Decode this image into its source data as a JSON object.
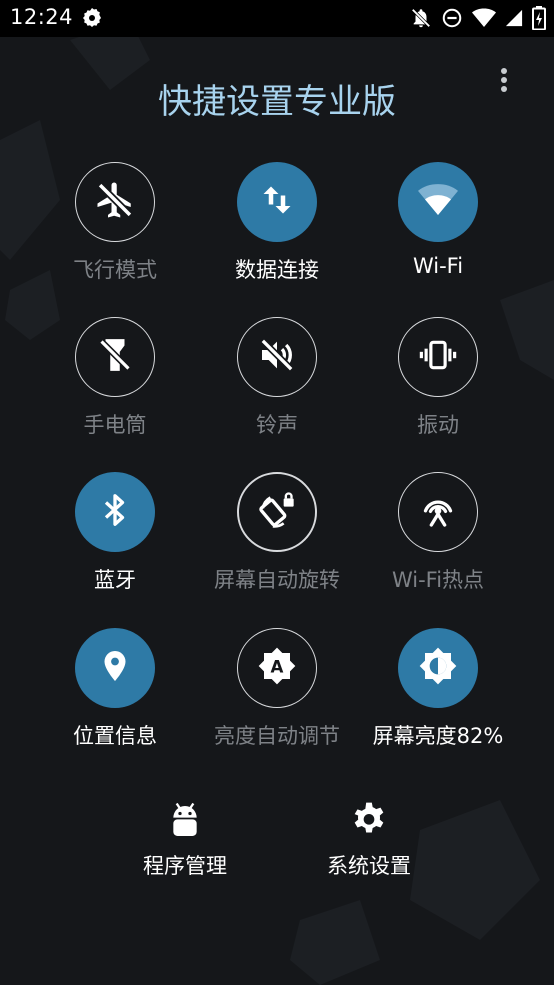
{
  "status_bar": {
    "time": "12:24",
    "left_icon": "gear-icon",
    "right_icons": [
      "notifications-off-icon",
      "do-not-disturb-icon",
      "wifi-icon",
      "cellular-signal-icon",
      "battery-charging-icon"
    ]
  },
  "header": {
    "title": "快捷设置专业版",
    "menu_icon": "overflow-menu-icon"
  },
  "tiles": [
    {
      "label": "飞行模式",
      "icon": "airplane-off-icon",
      "active": false
    },
    {
      "label": "数据连接",
      "icon": "data-transfer-icon",
      "active": true
    },
    {
      "label": "Wi-Fi",
      "icon": "wifi-icon",
      "active": true
    },
    {
      "label": "手电筒",
      "icon": "flashlight-off-icon",
      "active": false
    },
    {
      "label": "铃声",
      "icon": "volume-off-icon",
      "active": false
    },
    {
      "label": "振动",
      "icon": "vibrate-icon",
      "active": false
    },
    {
      "label": "蓝牙",
      "icon": "bluetooth-icon",
      "active": true
    },
    {
      "label": "屏幕自动旋转",
      "icon": "screen-rotation-lock-icon",
      "active": false
    },
    {
      "label": "Wi-Fi热点",
      "icon": "hotspot-icon",
      "active": false
    },
    {
      "label": "位置信息",
      "icon": "location-pin-icon",
      "active": true
    },
    {
      "label": "亮度自动调节",
      "icon": "brightness-auto-icon",
      "active": false
    },
    {
      "label": "屏幕亮度82%",
      "icon": "brightness-icon",
      "active": true
    }
  ],
  "bottom": [
    {
      "label": "程序管理",
      "icon": "android-icon"
    },
    {
      "label": "系统设置",
      "icon": "gear-icon"
    }
  ],
  "colors": {
    "background": "#15171a",
    "accent": "#2e7aa6",
    "title": "#a8d3ee",
    "label_active": "#ffffff",
    "label_inactive": "#7e8287"
  }
}
